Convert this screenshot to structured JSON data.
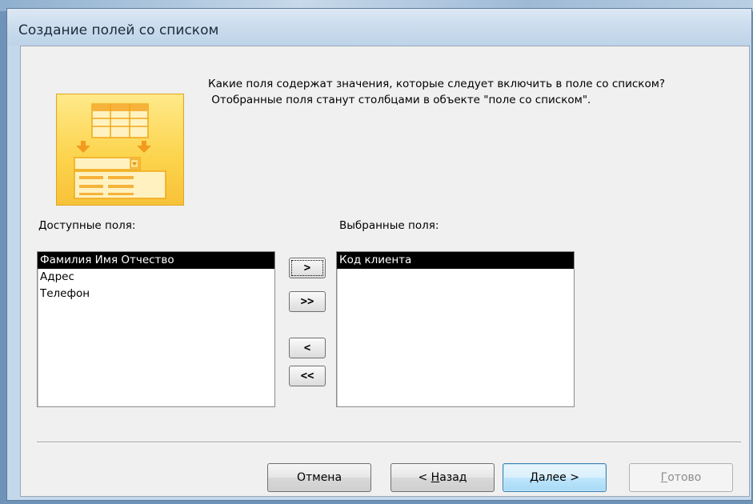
{
  "window": {
    "title": "Создание полей со списком"
  },
  "prompt": {
    "line1": "Какие поля содержат значения, которые следует включить в поле со списком?",
    "line2": " Отобранные поля станут столбцами в объекте \"поле со списком\"."
  },
  "available": {
    "label": "Доступные поля:",
    "items": [
      "Фамилия Имя Отчество",
      "Адрес",
      "Телефон"
    ],
    "selected_index": 0
  },
  "selected": {
    "label": "Выбранные поля:",
    "items": [
      "Код клиента"
    ],
    "selected_index": 0
  },
  "move_buttons": {
    "add_one": ">",
    "add_all": ">>",
    "remove_one": "<",
    "remove_all": "<<"
  },
  "footer": {
    "cancel": "Отмена",
    "back_prefix": "< ",
    "back_mnemonic": "Н",
    "back_rest": "азад",
    "next_mnemonic": "Д",
    "next_rest": "алее >",
    "finish_mnemonic": "Г",
    "finish_rest": "отово"
  },
  "colors": {
    "accent_image": "#fcd34a",
    "selection": "#000000",
    "window_frame": "#c4d7eb"
  }
}
